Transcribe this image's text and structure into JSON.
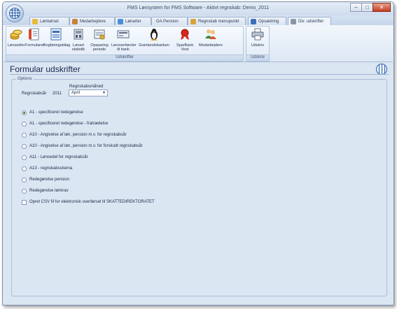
{
  "window": {
    "title": "FMS Lønsystem for FMS Software - Aktivt regnskab: Demo_2011"
  },
  "tabs": [
    {
      "label": "Lønkørsel",
      "color": "#e9b93a"
    },
    {
      "label": "Medarbejdere",
      "color": "#c9803a"
    },
    {
      "label": "Lønarter",
      "color": "#4a8fd6"
    },
    {
      "label": "GA Pension",
      "color": "#8aa6c8"
    },
    {
      "label": "Regnskab menupunkt",
      "color": "#d9a33a"
    },
    {
      "label": "Opsætning",
      "color": "#3a6fbf"
    },
    {
      "label": "Div. udskrifter",
      "color": "#8a97a8"
    }
  ],
  "ribbon": {
    "group1_label": "Udskrifter",
    "group2_label": "Udskriv",
    "buttons": [
      {
        "label": "Lønsedler",
        "icon": "coins-icon"
      },
      {
        "label": "Formularer",
        "icon": "form-icon"
      },
      {
        "label": "Bogføringsbilag",
        "icon": "ledger-icon"
      },
      {
        "label": "Lønart statistik",
        "icon": "statistics-icon"
      },
      {
        "label": "Opsparing periode",
        "icon": "savings-icon"
      },
      {
        "label": "Lønoverførsler til bank",
        "icon": "bank-icon"
      },
      {
        "label": "Grønlandsbanken",
        "icon": "penguin-icon"
      },
      {
        "label": "SparBank Vest",
        "icon": "ribbon-award-icon"
      },
      {
        "label": "Medarbejdere",
        "icon": "people-icon"
      }
    ],
    "print_button": {
      "label": "Udskriv",
      "icon": "printer-icon"
    }
  },
  "page": {
    "title": "Formular udskrifter"
  },
  "options": {
    "legend": "Options",
    "year_label": "Regnskabsår",
    "year_value": "2011",
    "month_label": "Regnskabsmåned",
    "month_value": "April",
    "radios": [
      {
        "label": "A1 - specificeret redegørelse",
        "selected": true
      },
      {
        "label": "A1 - specificeret redegørelse - fratrædelse",
        "selected": false
      },
      {
        "label": "A10 - Angivelse af løn, pension m.v. for regnskabsår",
        "selected": false
      },
      {
        "label": "A10 - Angivelse af løn, pension m.v. for forskudt regnskabsår",
        "selected": false
      },
      {
        "label": "A11 - Lønsedel for regnskabsår",
        "selected": false
      },
      {
        "label": "A13 - regnskabsskema",
        "selected": false
      },
      {
        "label": "Redegørelse pension",
        "selected": false
      },
      {
        "label": "Redegørelse lønkrav",
        "selected": false
      }
    ],
    "checkbox": {
      "label": "Opret CSV fil for elektronisk overførsel til SKATTEDIREKTORATET",
      "checked": false
    }
  }
}
